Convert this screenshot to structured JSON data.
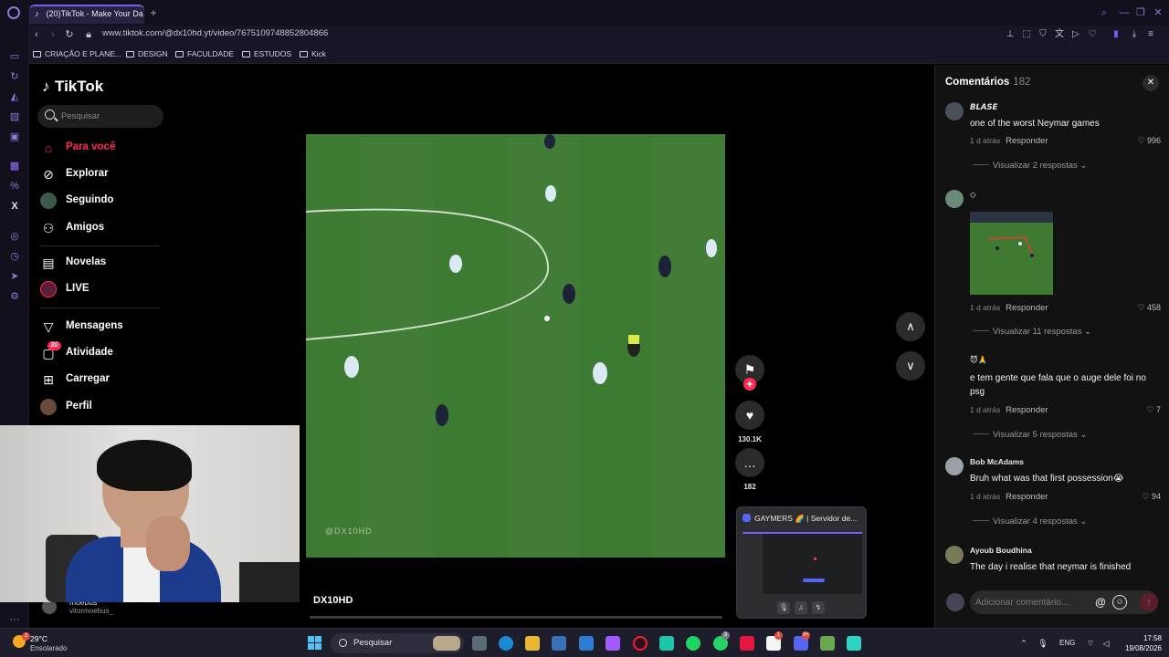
{
  "browser": {
    "tab_title": "(20)TikTok - Make Your Da",
    "url": "www.tiktok.com/@dx10hd.yt/video/7675109748852804866",
    "bookmarks": [
      "CRIAÇÃO E PLANE...",
      "DESIGN",
      "FACULDADE",
      "ESTUDOS",
      "Kick"
    ]
  },
  "tiktok": {
    "logo": "TikTok",
    "search_placeholder": "Pesquisar",
    "nav": [
      {
        "label": "Para você",
        "icon": "home-icon",
        "active": true
      },
      {
        "label": "Explorar",
        "icon": "compass-icon"
      },
      {
        "label": "Seguindo",
        "icon": "following-avatar-icon"
      },
      {
        "label": "Amigos",
        "icon": "friends-icon"
      },
      {
        "label": "Novelas",
        "icon": "novelas-icon"
      },
      {
        "label": "LIVE",
        "icon": "live-icon"
      },
      {
        "label": "Mensagens",
        "icon": "messages-icon"
      },
      {
        "label": "Atividade",
        "icon": "activity-icon",
        "badge": "20"
      },
      {
        "label": "Carregar",
        "icon": "upload-icon"
      },
      {
        "label": "Perfil",
        "icon": "profile-avatar-icon"
      }
    ],
    "mini_profile": {
      "name": "moebus",
      "handle": "vitormoebus_"
    }
  },
  "video": {
    "watermark": "@DX10HD",
    "author": "DX10HD",
    "likes": "130.1K",
    "comments": "182",
    "progress": 0.0
  },
  "discord_popup": {
    "title": "GAYMERS 🌈 | Servidor de..."
  },
  "comments_panel": {
    "title": "Comentários",
    "count": "182",
    "input_placeholder": "Adicionar comentário...",
    "items": [
      {
        "user": "𝘽𝙇𝘼𝙎𝙀",
        "text": "one of the worst Neymar games",
        "time": "1 d atrás",
        "reply": "Responder",
        "likes": "996",
        "more_replies": "Visualizar 2 respostas"
      },
      {
        "user": "◇",
        "text": "",
        "time": "1 d atrás",
        "reply": "Responder",
        "likes": "458",
        "more_replies": "Visualizar 11 respostas",
        "has_image": true
      },
      {
        "user": "😈🙏",
        "text": "e tem gente que fala que o auge dele foi no psg",
        "time": "1 d atrás",
        "reply": "Responder",
        "likes": "7",
        "more_replies": "Visualizar 5 respostas"
      },
      {
        "user": "Bob McAdams",
        "text": "Bruh what was that first possession😭",
        "time": "1 d atrás",
        "reply": "Responder",
        "likes": "94",
        "more_replies": "Visualizar 4 respostas"
      },
      {
        "user": "Ayoub Boudhina",
        "text": "The day i realise that neymar is finished"
      }
    ]
  },
  "taskbar": {
    "weather_temp": "29°C",
    "weather_cond": "Ensolarado",
    "weather_badge": "2",
    "search_label": "Pesquisar",
    "lang": "ENG",
    "time": "17:58",
    "date": "19/08/2026",
    "badges": {
      "whatsapp": "3",
      "discord": "9+",
      "notion": "1"
    }
  },
  "colors": {
    "accent": "#fe2c55",
    "pitch": "#3d7a32",
    "opera": "#7b5cf0"
  }
}
